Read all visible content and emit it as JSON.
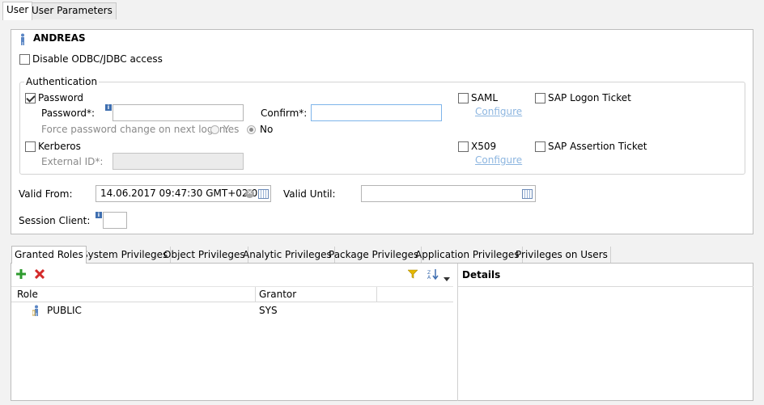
{
  "top_tabs": [
    {
      "label": "User",
      "active": true
    },
    {
      "label": "User Parameters",
      "active": false
    }
  ],
  "user": {
    "name": "ANDREAS",
    "disable_odbc_label": "Disable ODBC/JDBC access",
    "disable_odbc_checked": false
  },
  "auth": {
    "group_label": "Authentication",
    "password_label": "Password",
    "password_checked": true,
    "password_field_label": "Password*:",
    "password_value": "",
    "confirm_label": "Confirm*:",
    "confirm_value": "",
    "force_change_label": "Force password change on next logon:",
    "yes_label": "Yes",
    "no_label": "No",
    "force_change_selected": "No",
    "kerberos_label": "Kerberos",
    "kerberos_checked": false,
    "external_id_label": "External ID*:",
    "external_id_value": "",
    "saml_label": "SAML",
    "saml_checked": false,
    "saml_configure": "Configure",
    "x509_label": "X509",
    "x509_checked": false,
    "x509_configure": "Configure",
    "logon_ticket_label": "SAP Logon Ticket",
    "logon_ticket_checked": false,
    "assertion_ticket_label": "SAP Assertion Ticket",
    "assertion_ticket_checked": false
  },
  "validity": {
    "valid_from_label": "Valid From:",
    "valid_from_value": "14.06.2017 09:47:30 GMT+02:00",
    "valid_until_label": "Valid Until:",
    "valid_until_value": "",
    "session_client_label": "Session Client:",
    "session_client_value": ""
  },
  "bottom_tabs": [
    {
      "label": "Granted Roles",
      "active": true
    },
    {
      "label": "System Privileges",
      "active": false
    },
    {
      "label": "Object Privileges",
      "active": false
    },
    {
      "label": "Analytic Privileges",
      "active": false
    },
    {
      "label": "Package Privileges",
      "active": false
    },
    {
      "label": "Application Privileges",
      "active": false
    },
    {
      "label": "Privileges on Users",
      "active": false
    }
  ],
  "roles_table": {
    "columns": [
      "Role",
      "Grantor"
    ],
    "rows": [
      {
        "role": "PUBLIC",
        "grantor": "SYS"
      }
    ]
  },
  "details": {
    "title": "Details"
  },
  "colors": {
    "accent": "#7eb4ea",
    "link": "#8db6e0",
    "add_icon": "#2e9b2e",
    "remove_icon": "#d42a2a"
  }
}
